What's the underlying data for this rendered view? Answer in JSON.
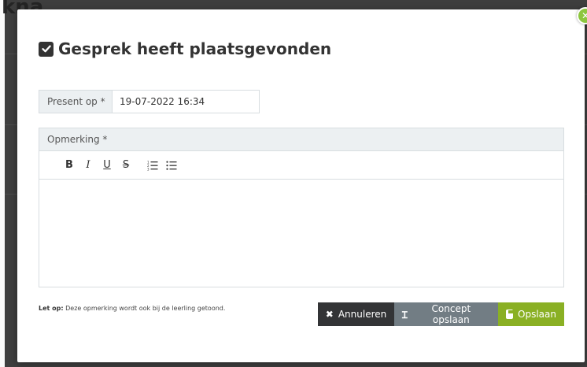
{
  "background": {
    "title_fragment": "kna"
  },
  "modal": {
    "title": "Gesprek heeft plaatsgevonden",
    "close_icon": "close-icon",
    "date_field": {
      "label": "Present op *",
      "value": "19-07-2022 16:34"
    },
    "editor": {
      "label": "Opmerking *",
      "toolbar": {
        "bold": "B",
        "italic": "I",
        "underline": "U",
        "strike": "S"
      },
      "content": ""
    },
    "note": {
      "prefix": "Let op:",
      "text": "Deze opmerking wordt ook bij de leerling getoond."
    },
    "buttons": {
      "cancel": "Annuleren",
      "concept": "Concept opslaan",
      "save": "Opslaan"
    }
  },
  "colors": {
    "accent_green": "#8ab024",
    "cancel_dark": "#333436",
    "concept_gray": "#727d84",
    "field_bg": "#ecf0f2"
  }
}
